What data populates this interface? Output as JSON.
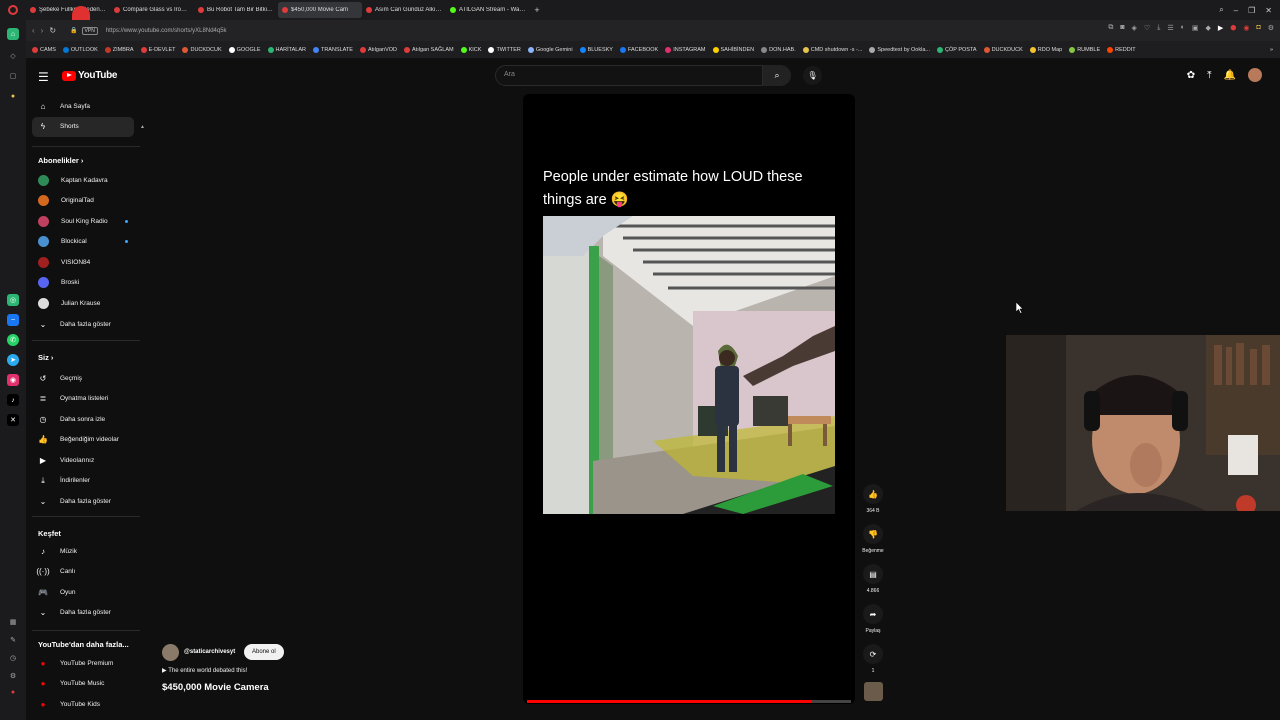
{
  "browser": {
    "tabs": [
      {
        "label": "Şebeke Fullken Neden İnit",
        "active": false
      },
      {
        "label": "Compare Glass vs Iron - Y",
        "active": false
      },
      {
        "label": "Bu Robot Tam Bir Bitki Gib",
        "active": false
      },
      {
        "label": "$450,000 Movie Cam",
        "active": true
      },
      {
        "label": "Asım Can Gündüz Alkışla",
        "active": false
      },
      {
        "label": "ATILGAN Stream - Watch",
        "active": false
      }
    ],
    "new_tab": "+",
    "vpn_label": "VPN",
    "url": "https://www.youtube.com/shorts/yXL8Nd4q5k",
    "bookmarks": [
      "CAMS",
      "OUTLOOK",
      "ZIMBRA",
      "E-DEVLET",
      "DUCKDCUK",
      "GOOGLE",
      "HARİTALAR",
      "TRANSLATE",
      "AtılganVOD",
      "Atılgan SAĞLAM",
      "KICK",
      "TWITTER",
      "Google Gemini",
      "BLUESKY",
      "FACEBOOK",
      "INSTAGRAM",
      "SAHİBİNDEN",
      "DON.HAB.",
      "CMD shutdown -s -...",
      "Speedtest by Ookla...",
      "ÇÖP POSTA",
      "DUCKDUCK",
      "RDO Map",
      "RUMBLE",
      "REDDIT"
    ],
    "bookmarks_more": "»"
  },
  "youtube": {
    "logo_text": "YouTube",
    "search_placeholder": "Ara",
    "guide": {
      "main": [
        {
          "label": "Ana Sayfa",
          "icon": "home-icon",
          "active": false
        },
        {
          "label": "Shorts",
          "icon": "shorts-icon",
          "active": true
        }
      ],
      "subs_title": "Abonelikler",
      "subs": [
        {
          "label": "Kaptan Kadavra",
          "color": "#2e8b57",
          "dot": false
        },
        {
          "label": "OriginalTad",
          "color": "#d2691e",
          "dot": false
        },
        {
          "label": "Soul King Radio",
          "color": "#c04060",
          "dot": true
        },
        {
          "label": "Blockical",
          "color": "#4a90d0",
          "dot": true
        },
        {
          "label": "VISION84",
          "color": "#a02020",
          "dot": false
        },
        {
          "label": "Broski",
          "color": "#5865f2",
          "dot": false
        },
        {
          "label": "Julian Krause",
          "color": "#dddddd",
          "dot": false
        }
      ],
      "subs_more": "Daha fazla göster",
      "you_title": "Siz",
      "you": [
        {
          "label": "Geçmiş",
          "icon": "history-icon"
        },
        {
          "label": "Oynatma listeleri",
          "icon": "playlists-icon"
        },
        {
          "label": "Daha sonra izle",
          "icon": "watch-later-icon"
        },
        {
          "label": "Beğendiğim videolar",
          "icon": "liked-icon"
        },
        {
          "label": "Videolarınız",
          "icon": "your-videos-icon"
        },
        {
          "label": "İndirilenler",
          "icon": "downloads-icon"
        },
        {
          "label": "Daha fazla göster",
          "icon": "chevron-down-icon"
        }
      ],
      "explore_title": "Keşfet",
      "explore": [
        {
          "label": "Müzik",
          "icon": "music-icon"
        },
        {
          "label": "Canlı",
          "icon": "live-icon"
        },
        {
          "label": "Oyun",
          "icon": "gaming-icon"
        },
        {
          "label": "Daha fazla göster",
          "icon": "chevron-down-icon"
        }
      ],
      "more_title": "YouTube'dan daha fazla...",
      "more": [
        {
          "label": "YouTube Premium"
        },
        {
          "label": "YouTube Music"
        },
        {
          "label": "YouTube Kids"
        }
      ]
    },
    "short": {
      "caption": "People under estimate how LOUD these things are 😝",
      "progress": 0.88,
      "actions": {
        "like_count": "364 B",
        "dislike_label": "Beğenme",
        "comment_count": "4.866",
        "share_label": "Paylaş",
        "remix_count": "1"
      },
      "channel_handle": "@staticarchivesyt",
      "subscribe_label": "Abone ol",
      "related_text": "The entire world debated this!",
      "title": "$450,000 Movie Camera"
    }
  }
}
